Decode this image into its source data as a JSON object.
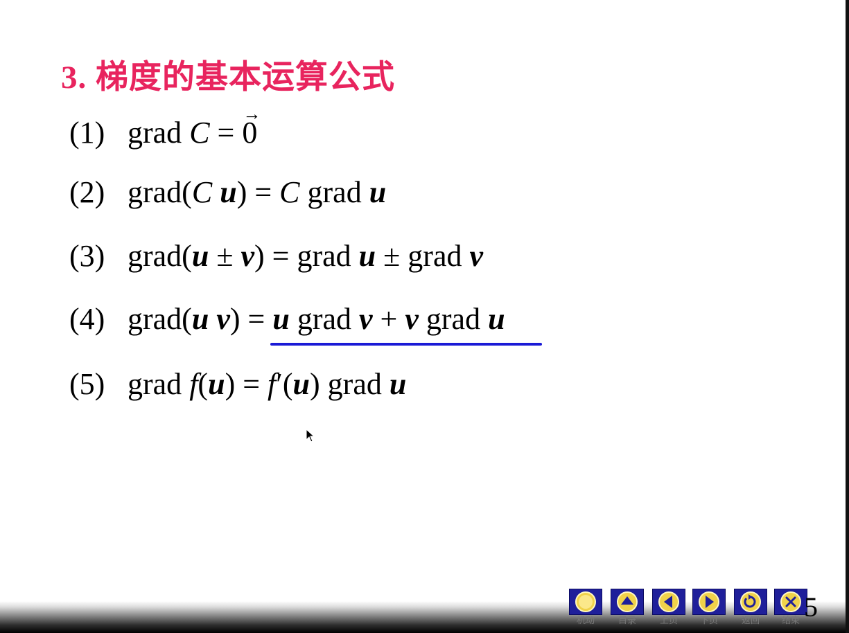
{
  "title": "3. 梯度的基本运算公式",
  "formulas": [
    {
      "num": "(1)"
    },
    {
      "num": "(2)"
    },
    {
      "num": "(3)"
    },
    {
      "num": "(4)"
    },
    {
      "num": "(5)"
    }
  ],
  "nav": {
    "items": [
      {
        "label": "机动",
        "icon": "circle-icon"
      },
      {
        "label": "目录",
        "icon": "triangle-up-icon"
      },
      {
        "label": "上页",
        "icon": "triangle-left-icon"
      },
      {
        "label": "下页",
        "icon": "triangle-right-icon"
      },
      {
        "label": "返回",
        "icon": "return-icon"
      },
      {
        "label": "结束",
        "icon": "close-icon"
      }
    ]
  },
  "page_number": "5",
  "colors": {
    "title": "#e8245e",
    "underline": "#1a1ad6",
    "nav_button": "#1f1f9a",
    "icon_fill": "#f0d24a"
  }
}
